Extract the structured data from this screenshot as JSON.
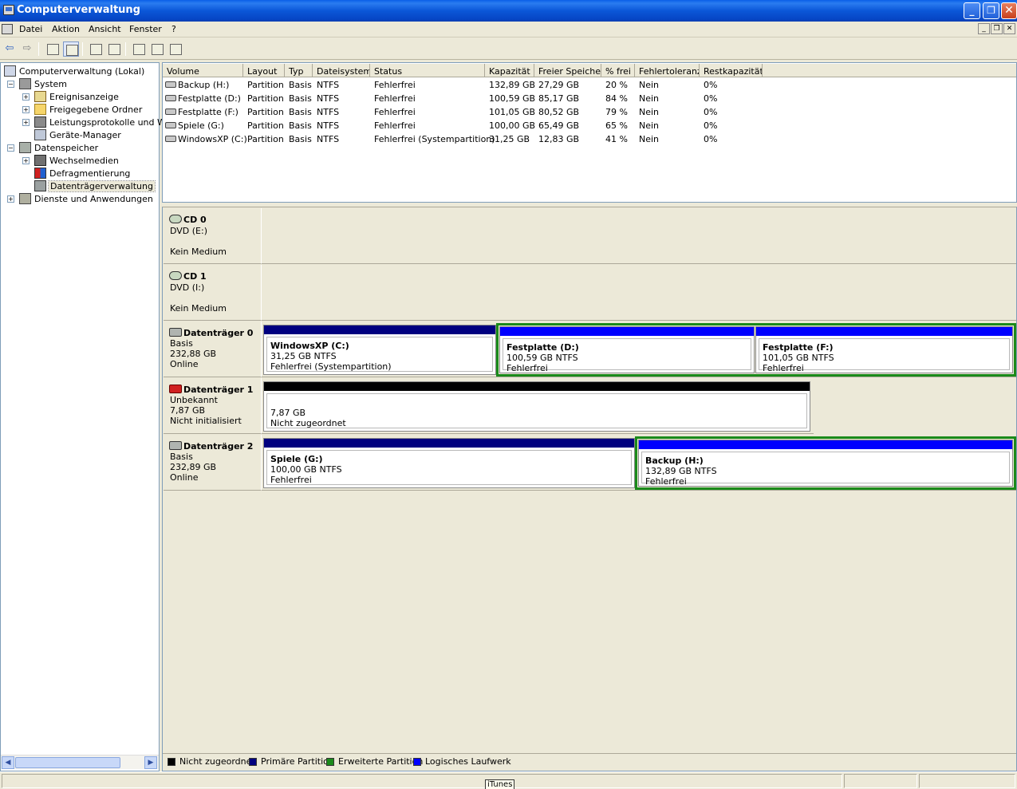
{
  "window": {
    "title": "Computerverwaltung"
  },
  "menu": {
    "items": [
      "Datei",
      "Aktion",
      "Ansicht",
      "Fenster",
      "?"
    ]
  },
  "tree": {
    "root": "Computerverwaltung (Lokal)",
    "system": "System",
    "event_viewer": "Ereignisanzeige",
    "shared_folders": "Freigegebene Ordner",
    "perf_logs": "Leistungsprotokolle und War",
    "device_manager": "Geräte-Manager",
    "storage": "Datenspeicher",
    "removable": "Wechselmedien",
    "defrag": "Defragmentierung",
    "disk_mgmt": "Datenträgerverwaltung",
    "services": "Dienste und Anwendungen"
  },
  "volumes": {
    "columns": [
      "Volume",
      "Layout",
      "Typ",
      "Dateisystem",
      "Status",
      "Kapazität",
      "Freier Speicher",
      "% frei",
      "Fehlertoleranz",
      "Restkapazität"
    ],
    "rows": [
      [
        "Backup (H:)",
        "Partition",
        "Basis",
        "NTFS",
        "Fehlerfrei",
        "132,89 GB",
        "27,29 GB",
        "20 %",
        "Nein",
        "0%"
      ],
      [
        "Festplatte (D:)",
        "Partition",
        "Basis",
        "NTFS",
        "Fehlerfrei",
        "100,59 GB",
        "85,17 GB",
        "84 %",
        "Nein",
        "0%"
      ],
      [
        "Festplatte (F:)",
        "Partition",
        "Basis",
        "NTFS",
        "Fehlerfrei",
        "101,05 GB",
        "80,52 GB",
        "79 %",
        "Nein",
        "0%"
      ],
      [
        "Spiele (G:)",
        "Partition",
        "Basis",
        "NTFS",
        "Fehlerfrei",
        "100,00 GB",
        "65,49 GB",
        "65 %",
        "Nein",
        "0%"
      ],
      [
        "WindowsXP (C:)",
        "Partition",
        "Basis",
        "NTFS",
        "Fehlerfrei (Systempartition)",
        "31,25 GB",
        "12,83 GB",
        "41 %",
        "Nein",
        "0%"
      ]
    ]
  },
  "disks": {
    "cd0": {
      "name": "CD 0",
      "line1": "DVD (E:)",
      "line2": "Kein Medium"
    },
    "cd1": {
      "name": "CD 1",
      "line1": "DVD (I:)",
      "line2": "Kein Medium"
    },
    "disk0": {
      "name": "Datenträger 0",
      "line1": "Basis",
      "line2": "232,88 GB",
      "line3": "Online",
      "parts": [
        {
          "name": "WindowsXP  (C:)",
          "size": "31,25 GB NTFS",
          "status": "Fehlerfrei (Systempartition)"
        },
        {
          "name": "Festplatte  (D:)",
          "size": "100,59 GB NTFS",
          "status": "Fehlerfrei"
        },
        {
          "name": "Festplatte  (F:)",
          "size": "101,05 GB NTFS",
          "status": "Fehlerfrei"
        }
      ]
    },
    "disk1": {
      "name": "Datenträger 1",
      "line1": "Unbekannt",
      "line2": "7,87 GB",
      "line3": "Nicht initialisiert",
      "parts": [
        {
          "size": "7,87 GB",
          "status": "Nicht zugeordnet"
        }
      ]
    },
    "disk2": {
      "name": "Datenträger 2",
      "line1": "Basis",
      "line2": "232,89 GB",
      "line3": "Online",
      "parts": [
        {
          "name": "Spiele  (G:)",
          "size": "100,00 GB NTFS",
          "status": "Fehlerfrei"
        },
        {
          "name": "Backup  (H:)",
          "size": "132,89 GB NTFS",
          "status": "Fehlerfrei"
        }
      ]
    }
  },
  "legend": {
    "unallocated": "Nicht zugeordnet",
    "primary": "Primäre Partition",
    "extended": "Erweiterte Partition",
    "logical": "Logisches Laufwerk"
  },
  "colors": {
    "primary": "#00007f",
    "logical": "#0000ff",
    "extended": "#1a8a1a",
    "unallocated": "#000000"
  },
  "taskbar_tip": "iTunes"
}
